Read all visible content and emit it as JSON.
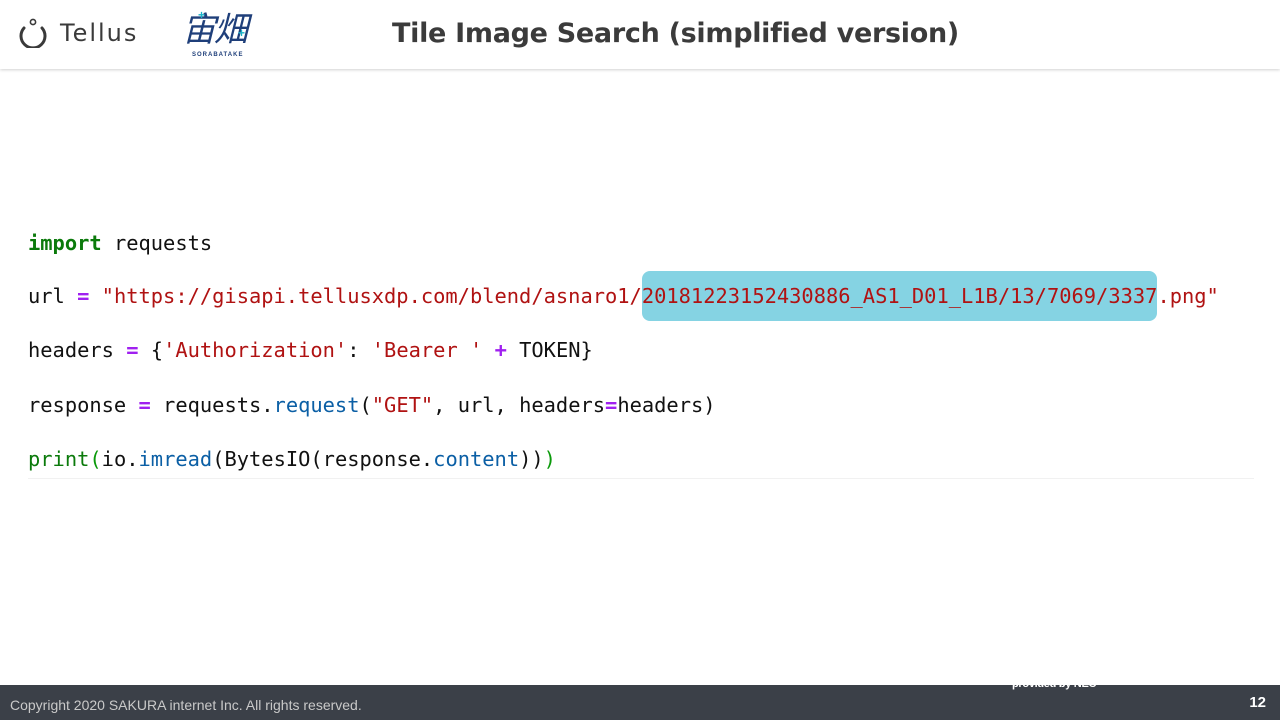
{
  "header": {
    "tellus_wordmark": "Tellus",
    "sorabatake_logo": "宙畑",
    "sorabatake_sub": "SORABATAKE",
    "title": "Tile Image Search (simplified version)"
  },
  "code": {
    "line1": {
      "kw": "import",
      "rest": " requests"
    },
    "line2": {
      "var": "url ",
      "op": "=",
      "str_pre": " \"https://gisapi.tellusxdp.com/blend/asnaro1/",
      "str_highlight": "20181223152430886_AS1_D01_L1B/13/7069/3337",
      "str_post": ".png\""
    },
    "line3": {
      "var": "headers ",
      "op1": "=",
      "brace_open": " {",
      "key": "'Authorization'",
      "colon": ": ",
      "val": "'Bearer '",
      "space1": " ",
      "op2": "+",
      "token": " TOKEN}"
    },
    "line4": {
      "var": "response ",
      "op1": "=",
      "obj": " requests.",
      "fn": "request",
      "p_open": "(",
      "arg1": "\"GET\"",
      "rest1": ", url, headers",
      "op2": "=",
      "rest2": "headers)"
    },
    "line5": {
      "bi": "print",
      "p1": "(",
      "mod": "io.",
      "fn": "imread",
      "mid": "(BytesIO(response.",
      "attr": "content",
      "close": "))",
      "p2": ")"
    }
  },
  "footer": {
    "copyright": "Copyright 2020 SAKURA  internet Inc.  All rights reserved.",
    "provided_by": "provided by NEC",
    "page_number": "12"
  },
  "colors": {
    "highlight": "#85d3e3",
    "keyword": "#0b7a0b",
    "operator": "#a020f0",
    "string": "#b01212",
    "function": "#0b5fa5",
    "footer_bg": "#3b4048"
  },
  "icons": {
    "tellus": "tellus-ring-icon",
    "sorabatake": "sorabatake-logo"
  }
}
